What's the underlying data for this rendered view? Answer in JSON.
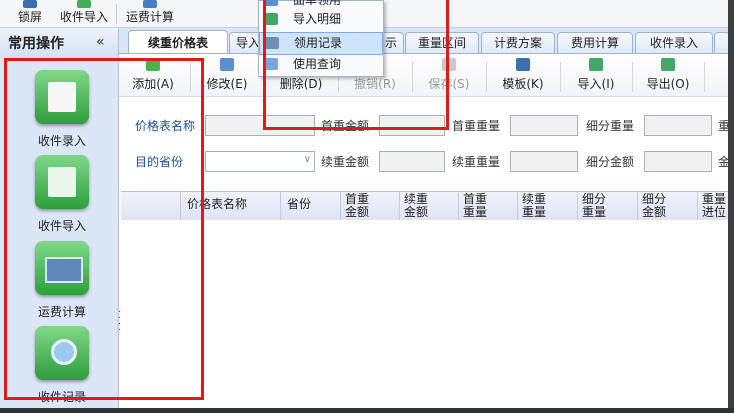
{
  "top_toolbar": {
    "items": [
      {
        "label": "锁屏",
        "icon": "lock-icon"
      },
      {
        "label": "收件导入",
        "icon": "import-icon"
      },
      {
        "label": "运费计算",
        "icon": "calc-icon"
      }
    ]
  },
  "dropdown": {
    "items": [
      {
        "label": "面单领用",
        "icon": "waybill-icon"
      },
      {
        "label": "导入明细",
        "icon": "import-detail-icon"
      },
      {
        "label": "领用记录",
        "icon": "record-icon",
        "highlighted": true
      },
      {
        "label": "使用查询",
        "icon": "query-icon"
      }
    ]
  },
  "sidebar": {
    "title": "常用操作",
    "collapse": "«",
    "items": [
      {
        "label": "收件录入",
        "icon": "entry-icon"
      },
      {
        "label": "收件导入",
        "icon": "excel-import-icon"
      },
      {
        "label": "运费计算",
        "icon": "box-icon"
      },
      {
        "label": "收件记录",
        "icon": "search-record-icon"
      }
    ]
  },
  "tabs": [
    {
      "label": "续重价格表",
      "active": true
    },
    {
      "label": "导入"
    },
    {
      "label": "示"
    },
    {
      "label": "重量区间"
    },
    {
      "label": "计费方案"
    },
    {
      "label": "费用计算"
    },
    {
      "label": "收件录入"
    }
  ],
  "toolbar": {
    "add": "添加(A)",
    "edit": "修改(E)",
    "delete": "删除(D)",
    "undo": "撤销(R)",
    "save": "保存(S)",
    "template": "模板(K)",
    "import": "导入(I)",
    "export": "导出(O)"
  },
  "form": {
    "price_table_name_label": "价格表名称",
    "first_weight_amount_label": "首重金额",
    "first_weight_label": "首重重量",
    "sub_weight_label": "细分重量",
    "dest_province_label": "目的省份",
    "cont_weight_amount_label": "续重金额",
    "cont_weight_label": "续重重量",
    "sub_amount_label": "细分金额",
    "cut_right_1": "重",
    "cut_right_2": "金"
  },
  "grid": {
    "columns": [
      {
        "l1": "价格表名称",
        "l2": ""
      },
      {
        "l1": "省份",
        "l2": ""
      },
      {
        "l1": "首重",
        "l2": "金额"
      },
      {
        "l1": "续重",
        "l2": "金额"
      },
      {
        "l1": "首重",
        "l2": "重量"
      },
      {
        "l1": "续重",
        "l2": "重量"
      },
      {
        "l1": "细分",
        "l2": "重量"
      },
      {
        "l1": "细分",
        "l2": "金额"
      },
      {
        "l1": "重量",
        "l2": "进位"
      }
    ]
  },
  "colors": {
    "annotation_red": "#e01a1a",
    "panel_blue": "#dbe7f6",
    "icon_green": "#2e9e3b"
  }
}
